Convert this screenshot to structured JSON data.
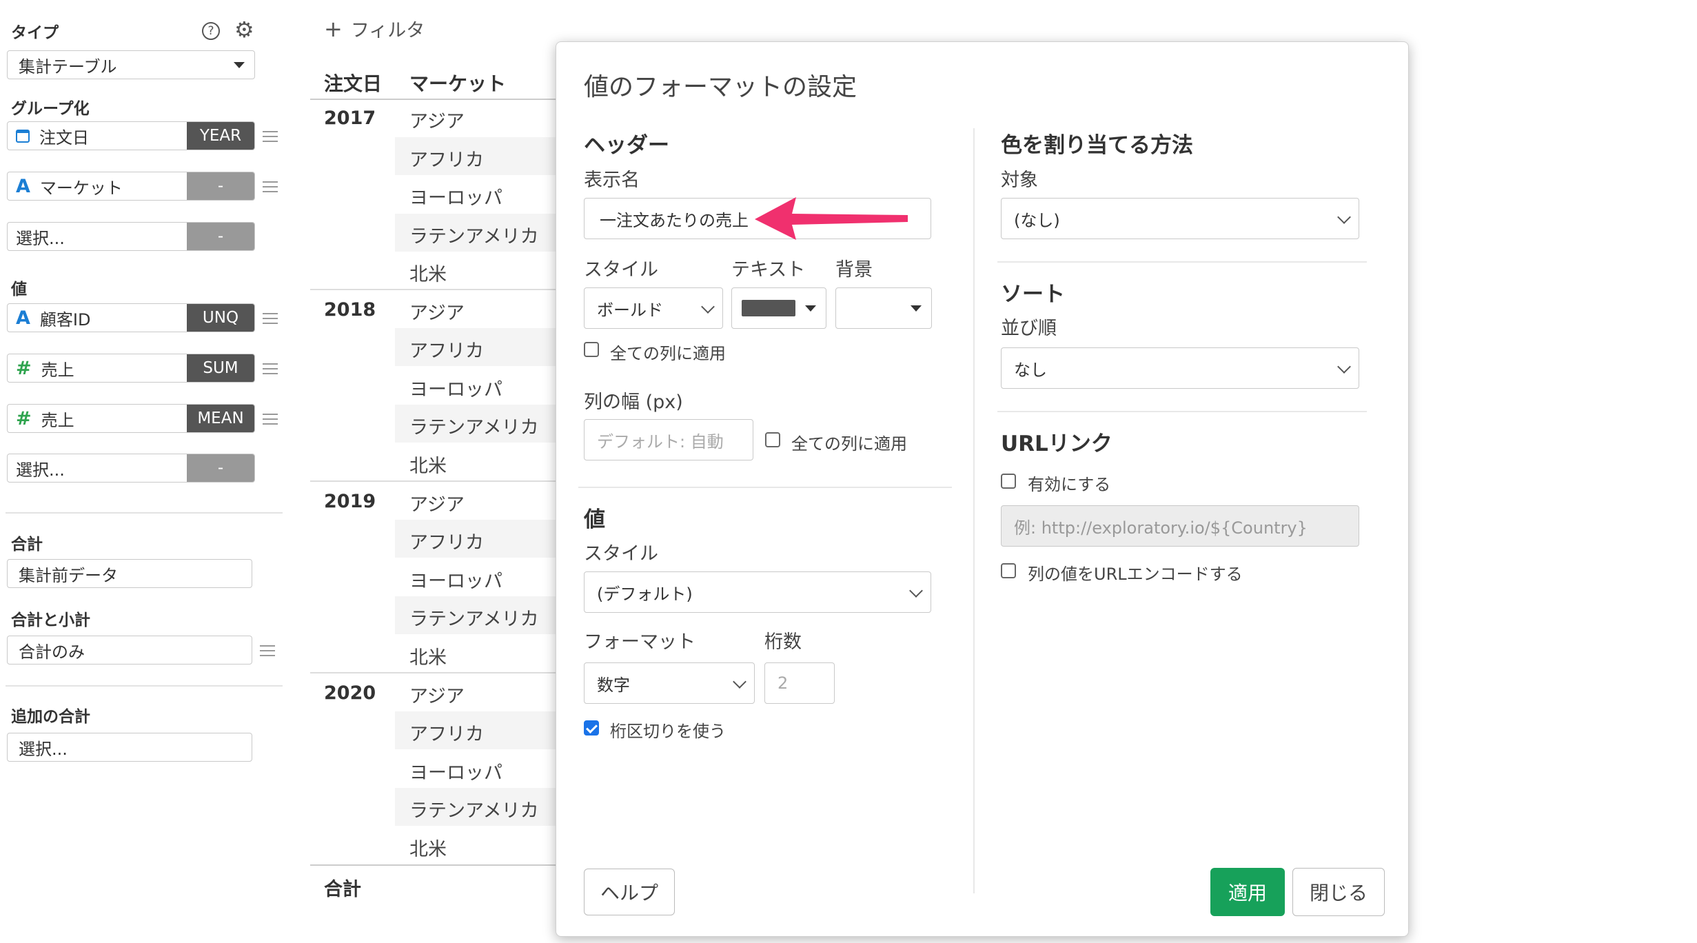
{
  "sidebar": {
    "type_label": "タイプ",
    "type_value": "集計テーブル",
    "group_label": "グループ化",
    "group_fields": [
      {
        "name": "注文日",
        "tag": "YEAR",
        "icon": "calendar-icon"
      },
      {
        "name": "マーケット",
        "tag": "-",
        "icon": "text-type-icon"
      },
      {
        "name": "選択...",
        "tag": "-",
        "icon": ""
      }
    ],
    "value_label": "値",
    "value_fields": [
      {
        "name": "顧客ID",
        "tag": "UNQ",
        "icon": "text-type-icon"
      },
      {
        "name": "売上",
        "tag": "SUM",
        "icon": "number-type-icon"
      },
      {
        "name": "売上",
        "tag": "MEAN",
        "icon": "number-type-icon"
      },
      {
        "name": "選択...",
        "tag": "-",
        "icon": ""
      }
    ],
    "total_label": "合計",
    "total_value": "集計前データ",
    "subtotal_label": "合計と小計",
    "subtotal_value": "合計のみ",
    "extra_total_label": "追加の合計",
    "extra_total_value": "選択..."
  },
  "filter": {
    "label": "フィルタ"
  },
  "table": {
    "headers": [
      "注文日",
      "マーケット"
    ],
    "groups": [
      {
        "year": "2017",
        "markets": [
          "アジア",
          "アフリカ",
          "ヨーロッパ",
          "ラテンアメリカ",
          "北米"
        ]
      },
      {
        "year": "2018",
        "markets": [
          "アジア",
          "アフリカ",
          "ヨーロッパ",
          "ラテンアメリカ",
          "北米"
        ]
      },
      {
        "year": "2019",
        "markets": [
          "アジア",
          "アフリカ",
          "ヨーロッパ",
          "ラテンアメリカ",
          "北米"
        ]
      },
      {
        "year": "2020",
        "markets": [
          "アジア",
          "アフリカ",
          "ヨーロッパ",
          "ラテンアメリカ",
          "北米"
        ]
      }
    ],
    "total_label": "合計"
  },
  "modal": {
    "title": "値のフォーマットの設定",
    "header_section": "ヘッダー",
    "display_name_label": "表示名",
    "display_name_value": "一注文あたりの売上",
    "style_label": "スタイル",
    "text_label": "テキスト",
    "bg_label": "背景",
    "style_value": "ボールド",
    "text_color": "#555555",
    "apply_all_label": "全ての列に適用",
    "width_label": "列の幅 (px)",
    "width_placeholder": "デフォルト: 自動",
    "width_apply_all_label": "全ての列に適用",
    "value_section": "値",
    "value_style_label": "スタイル",
    "value_style_value": "(デフォルト)",
    "format_label": "フォーマット",
    "digits_label": "桁数",
    "format_value": "数字",
    "digits_placeholder": "2",
    "separator_label": "桁区切りを使う",
    "separator_checked": true,
    "color_section": "色を割り当てる方法",
    "target_label": "対象",
    "target_value": "(なし)",
    "sort_section": "ソート",
    "order_label": "並び順",
    "order_value": "なし",
    "url_section": "URLリンク",
    "enable_label": "有効にする",
    "url_placeholder": "例: http://exploratory.io/${Country}",
    "url_encode_label": "列の値をURLエンコードする",
    "help_button": "ヘルプ",
    "apply_button": "適用",
    "close_button": "閉じる"
  },
  "colors": {
    "apply_button": "#17a15a",
    "annotation_arrow": "#f0306e",
    "checkbox_checked": "#1a73e8"
  }
}
